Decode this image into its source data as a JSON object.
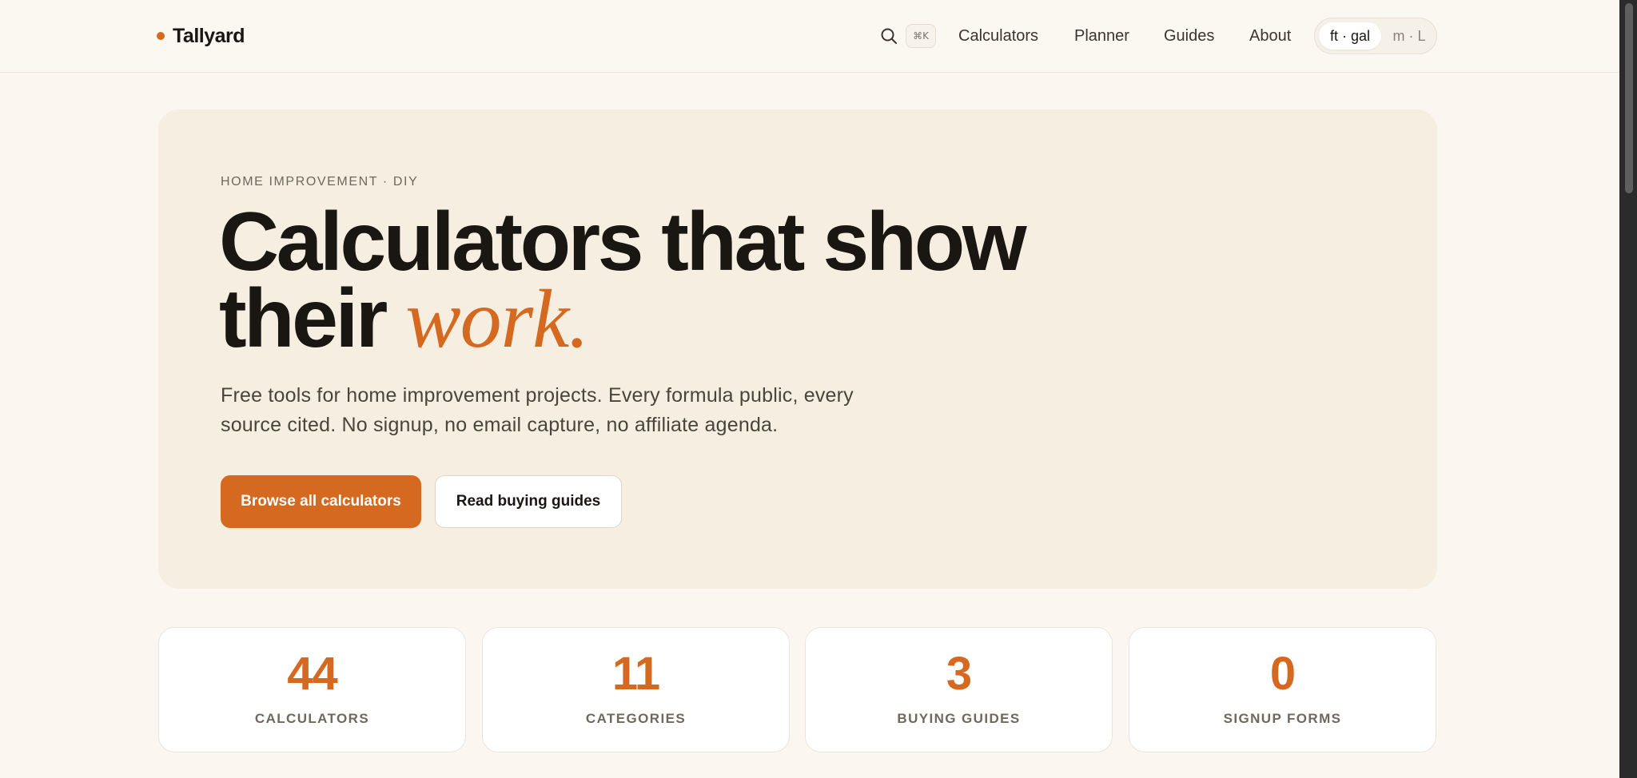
{
  "header": {
    "brand": "Tallyard",
    "search_icon": "search-icon",
    "shortcut": "⌘K",
    "nav": [
      "Calculators",
      "Planner",
      "Guides",
      "About"
    ],
    "units": {
      "imperial": "ft · gal",
      "metric": "m · L",
      "selected": "imperial"
    }
  },
  "hero": {
    "eyebrow": "HOME IMPROVEMENT · DIY",
    "headline_line1": "Calculators that show",
    "headline_line2": "their",
    "headline_accent": "work.",
    "lede": "Free tools for home improvement projects. Every formula public, every source cited. No signup, no email capture, no affiliate agenda.",
    "primary_cta": "Browse all calculators",
    "secondary_cta": "Read buying guides"
  },
  "stats": [
    {
      "value": "44",
      "label": "CALCULATORS"
    },
    {
      "value": "11",
      "label": "CATEGORIES"
    },
    {
      "value": "3",
      "label": "BUYING GUIDES"
    },
    {
      "value": "0",
      "label": "SIGNUP FORMS"
    }
  ],
  "colors": {
    "accent": "#d4691f",
    "background": "#fbf6ef",
    "hero_bg": "#f5eee1",
    "text": "#1a1712"
  }
}
